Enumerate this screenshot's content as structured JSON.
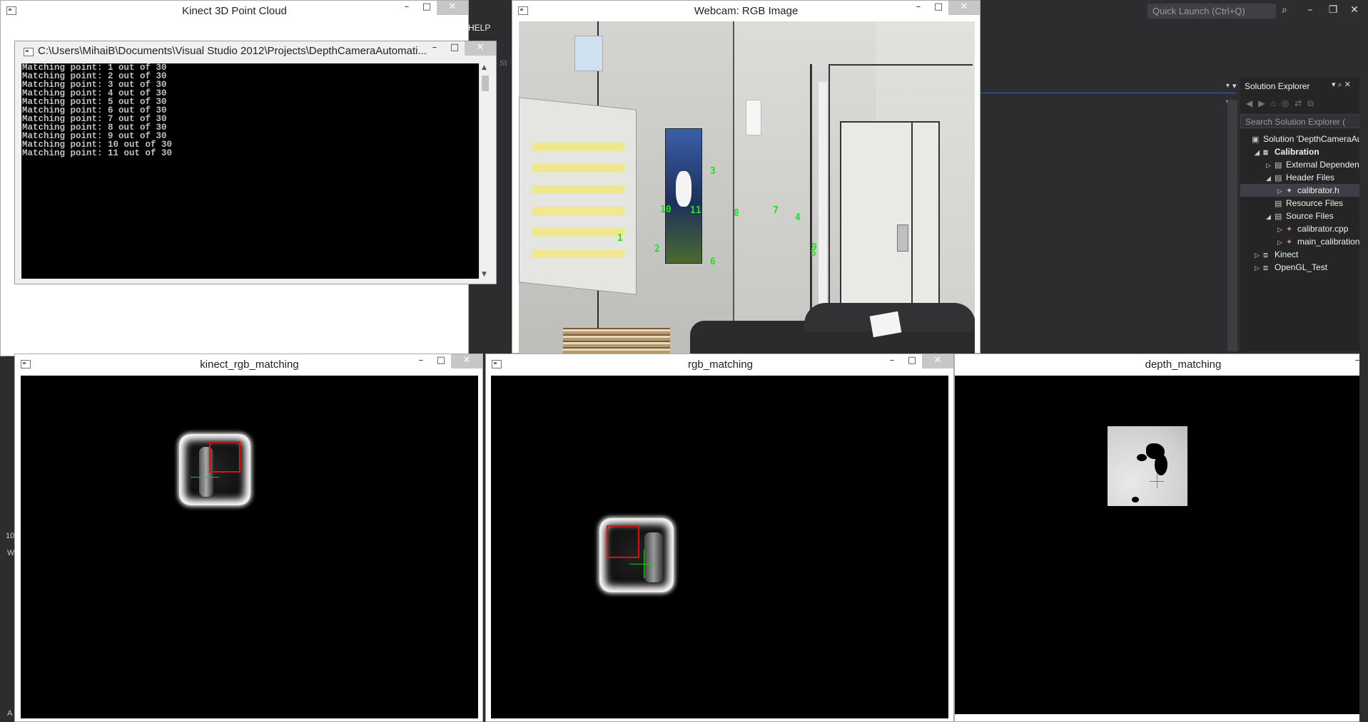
{
  "vs": {
    "help_menu": "HELP",
    "quick_launch_placeholder": "Quick Launch (Ctrl+Q)",
    "side_stub_1": "St",
    "side_stub_2": "10",
    "side_stub_3": "W",
    "side_stub_4": "A"
  },
  "solution_explorer": {
    "title": "Solution Explorer",
    "search_placeholder": "Search Solution Explorer (",
    "items": [
      {
        "label": "Solution 'DepthCameraAut",
        "level": 0,
        "expand": ""
      },
      {
        "label": "Calibration",
        "level": 1,
        "expand": "◢"
      },
      {
        "label": "External Dependenc",
        "level": 2,
        "expand": "▷"
      },
      {
        "label": "Header Files",
        "level": 2,
        "expand": "◢"
      },
      {
        "label": "calibrator.h",
        "level": 3,
        "expand": "▷"
      },
      {
        "label": "Resource Files",
        "level": 2,
        "expand": ""
      },
      {
        "label": "Source Files",
        "level": 2,
        "expand": "◢"
      },
      {
        "label": "calibrator.cpp",
        "level": 3,
        "expand": "▷"
      },
      {
        "label": "main_calibration",
        "level": 3,
        "expand": "▷"
      },
      {
        "label": "Kinect",
        "level": 1,
        "expand": "▷"
      },
      {
        "label": "OpenGL_Test",
        "level": 1,
        "expand": "▷"
      }
    ]
  },
  "windows": {
    "point_cloud_title": "Kinect 3D Point Cloud",
    "webcam_title": "Webcam: RGB Image",
    "console_title": "C:\\Users\\MihaiB\\Documents\\Visual Studio 2012\\Projects\\DepthCameraAutomati...",
    "kinect_rgb_title": "kinect_rgb_matching",
    "rgb_title": "rgb_matching",
    "depth_title": "depth_matching"
  },
  "console_lines": [
    "Matching point: 1 out of 30",
    "Matching point: 2 out of 30",
    "Matching point: 3 out of 30",
    "Matching point: 4 out of 30",
    "Matching point: 5 out of 30",
    "Matching point: 6 out of 30",
    "Matching point: 7 out of 30",
    "Matching point: 8 out of 30",
    "Matching point: 9 out of 30",
    "Matching point: 10 out of 30",
    "Matching point: 11 out of 30"
  ],
  "webcam_points": [
    "1",
    "2",
    "3",
    "4",
    "5",
    "6",
    "7",
    "8",
    "9",
    "10",
    "11"
  ],
  "colors": {
    "vs_bg": "#2d2d30",
    "vs_accent": "#007acc",
    "point_label": "#22e022",
    "match_box": "#e01010",
    "crosshair": "#22c022"
  }
}
